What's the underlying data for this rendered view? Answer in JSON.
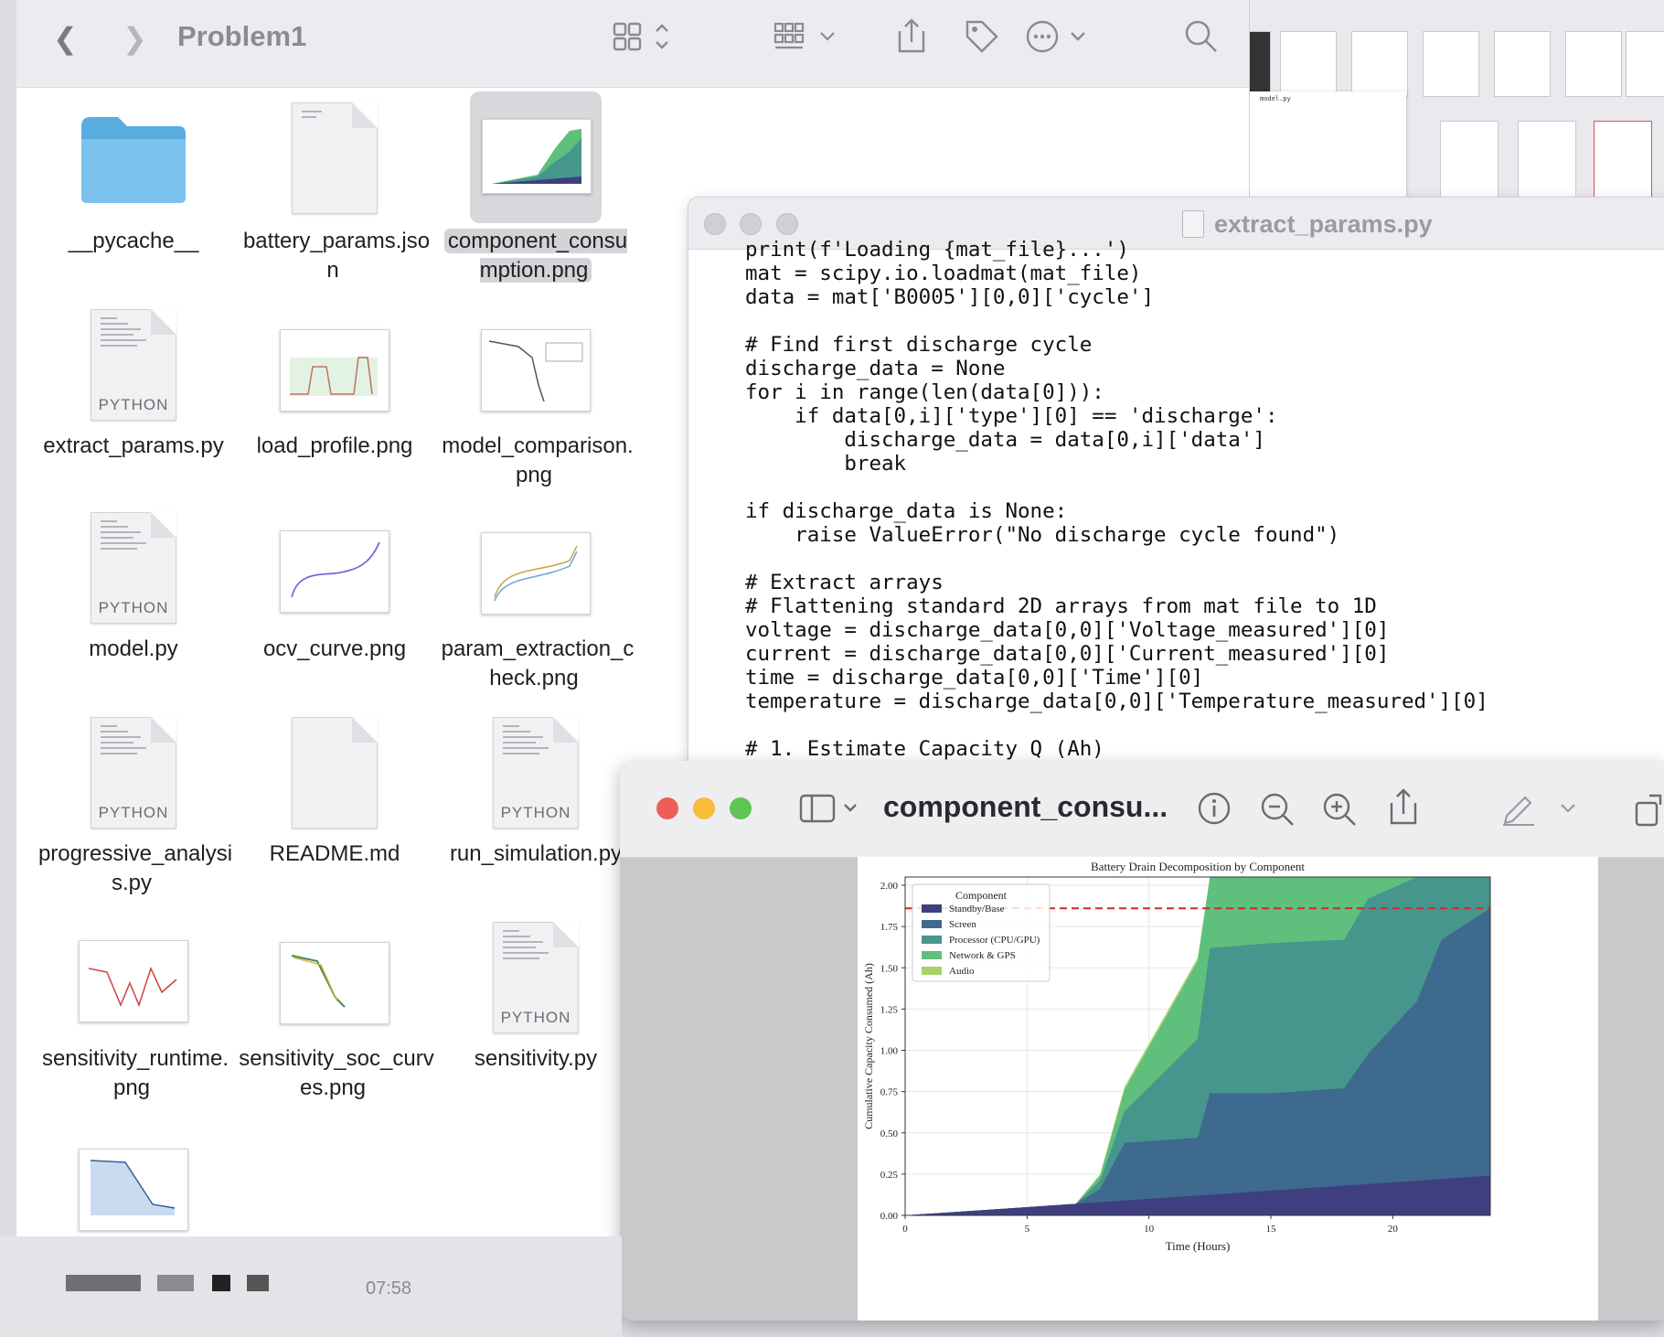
{
  "finder": {
    "title": "Problem1",
    "items": [
      {
        "label": "__pycache__",
        "kind": "folder"
      },
      {
        "label": "battery_params.json",
        "kind": "file"
      },
      {
        "label": "component_consumption.png",
        "kind": "image",
        "selected": true
      },
      {
        "label": "extract_params.py",
        "kind": "python"
      },
      {
        "label": "load_profile.png",
        "kind": "image"
      },
      {
        "label": "model_comparison.png",
        "kind": "image"
      },
      {
        "label": "model.py",
        "kind": "python"
      },
      {
        "label": "ocv_curve.png",
        "kind": "image"
      },
      {
        "label": "param_extraction_check.png",
        "kind": "image"
      },
      {
        "label": "progressive_analysis.py",
        "kind": "python"
      },
      {
        "label": "README.md",
        "kind": "file"
      },
      {
        "label": "run_simulation.py",
        "kind": "python"
      },
      {
        "label": "sensitivity_runtime.png",
        "kind": "image"
      },
      {
        "label": "sensitivity_soc_curves.png",
        "kind": "image"
      },
      {
        "label": "sensitivity.py",
        "kind": "python"
      },
      {
        "label": "",
        "kind": "image"
      }
    ],
    "python_badge": "PYTHON"
  },
  "code_window": {
    "title": "extract_params.py",
    "lines": [
      "print(f'Loading {mat_file}...')",
      "mat = scipy.io.loadmat(mat_file)",
      "data = mat['B0005'][0,0]['cycle']",
      "",
      "# Find first discharge cycle",
      "discharge_data = None",
      "for i in range(len(data[0])):",
      "    if data[0,i]['type'][0] == 'discharge':",
      "        discharge_data = data[0,i]['data']",
      "        break",
      "",
      "if discharge_data is None:",
      "    raise ValueError(\"No discharge cycle found\")",
      "",
      "# Extract arrays",
      "# Flattening standard 2D arrays from mat file to 1D",
      "voltage = discharge_data[0,0]['Voltage_measured'][0]",
      "current = discharge_data[0,0]['Current_measured'][0]",
      "time = discharge_data[0,0]['Time'][0]",
      "temperature = discharge_data[0,0]['Temperature_measured'][0]",
      "",
      "# 1. Estimate Capacity Q (Ah)"
    ]
  },
  "preview_window": {
    "title": "component_consu..."
  },
  "bottom_strip": {
    "time": "07:58"
  },
  "background_window": {
    "tab": "model.py"
  },
  "chart_data": {
    "type": "area",
    "title": "Battery Drain Decomposition by Component",
    "xlabel": "Time (Hours)",
    "ylabel": "Cumulative Capacity Consumed (Ah)",
    "xlim": [
      0,
      24
    ],
    "ylim": [
      0,
      2.05
    ],
    "xticks": [
      "0",
      "5",
      "10",
      "15",
      "20"
    ],
    "yticks": [
      "0.00",
      "0.25",
      "0.50",
      "0.75",
      "1.00",
      "1.25",
      "1.50",
      "1.75",
      "2.00"
    ],
    "grid": true,
    "legend_title": "Component",
    "legend_position": "top-left",
    "reference_line": {
      "y": 1.86,
      "style": "dashed",
      "color": "#d62728"
    },
    "x": [
      0,
      7,
      8,
      9,
      12,
      12.5,
      15,
      18,
      19,
      21,
      22,
      24
    ],
    "series": [
      {
        "name": "Standby/Base",
        "color": "#3f3f7f",
        "values": [
          0,
          0.07,
          0.08,
          0.09,
          0.12,
          0.125,
          0.15,
          0.18,
          0.19,
          0.21,
          0.22,
          0.24
        ]
      },
      {
        "name": "Screen",
        "color": "#3d6a8e",
        "values": [
          0,
          0.07,
          0.16,
          0.44,
          0.47,
          0.74,
          0.74,
          0.77,
          0.98,
          1.3,
          1.67,
          1.86
        ]
      },
      {
        "name": "Processor (CPU/GPU)",
        "color": "#46968e",
        "values": [
          0,
          0.07,
          0.21,
          0.63,
          1.07,
          1.62,
          1.65,
          1.67,
          1.92,
          2.05,
          2.05,
          2.05
        ]
      },
      {
        "name": "Network & GPS",
        "color": "#5fbf7c",
        "values": [
          0,
          0.07,
          0.24,
          0.76,
          1.54,
          2.05,
          2.05,
          2.05,
          2.05,
          2.05,
          2.05,
          2.05
        ]
      },
      {
        "name": "Audio",
        "color": "#a7d46a",
        "values": [
          0,
          0.07,
          0.25,
          0.78,
          1.56,
          2.05,
          2.05,
          2.05,
          2.05,
          2.05,
          2.05,
          2.05
        ]
      }
    ]
  }
}
